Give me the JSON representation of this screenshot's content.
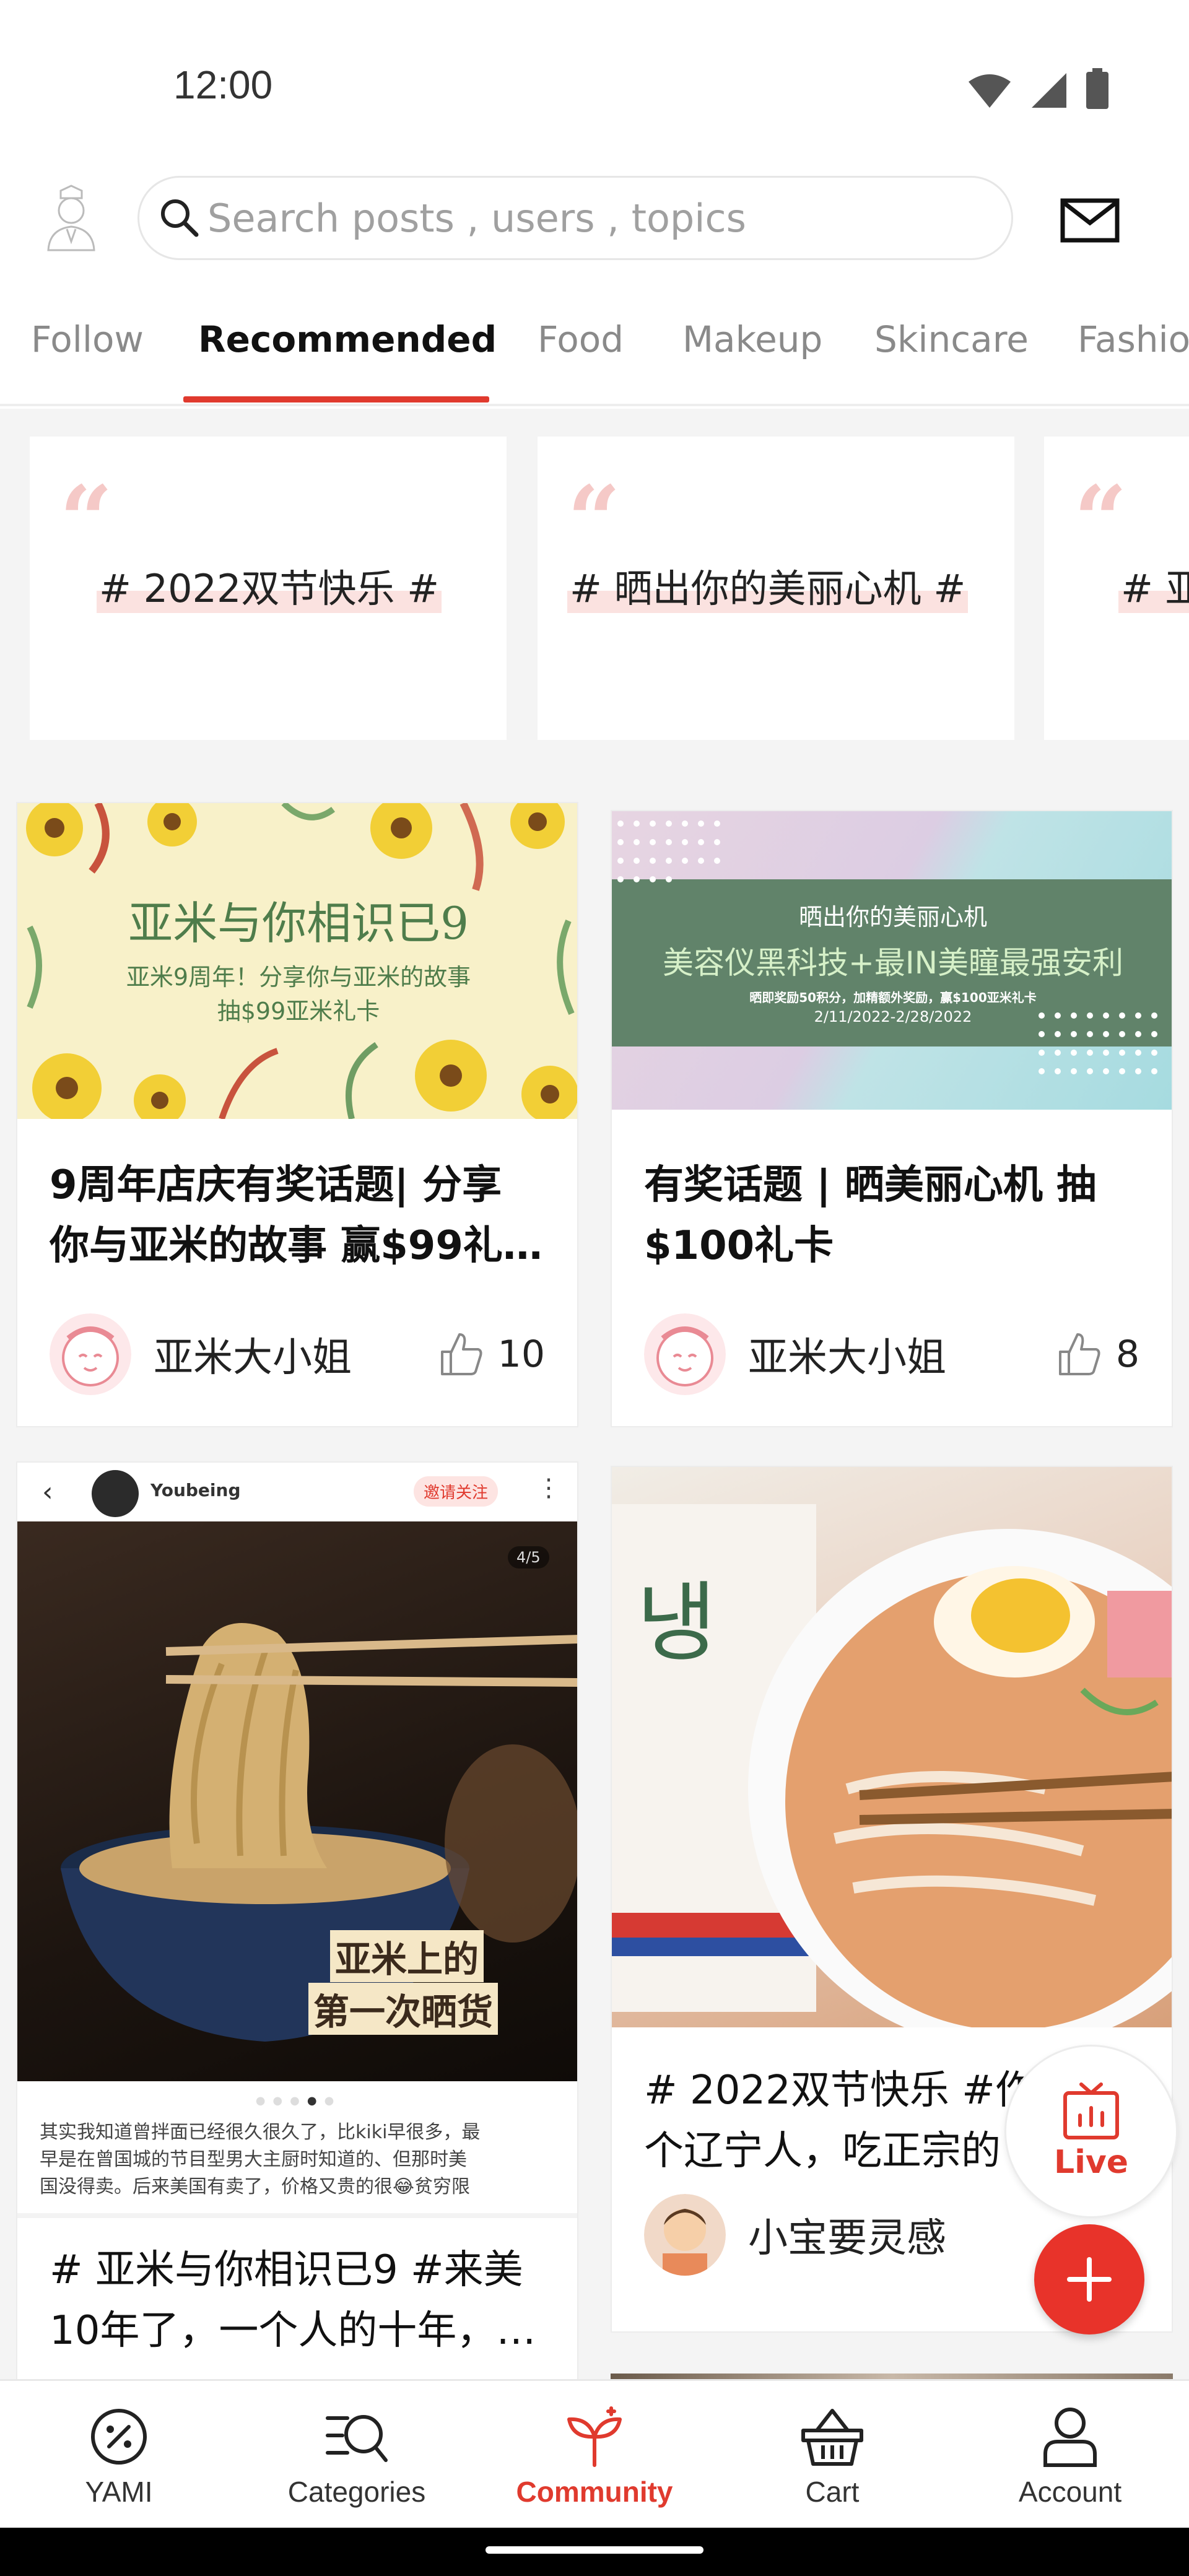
{
  "status_bar": {
    "time": "12:00"
  },
  "header": {
    "search_placeholder": "Search posts , users , topics",
    "icons": [
      "profile-avatar-icon",
      "search-icon",
      "mail-icon"
    ]
  },
  "tabs": [
    {
      "label": "Follow",
      "active": false
    },
    {
      "label": "Recommended",
      "active": true
    },
    {
      "label": "Food",
      "active": false
    },
    {
      "label": "Makeup",
      "active": false
    },
    {
      "label": "Skincare",
      "active": false
    },
    {
      "label": "Fashion",
      "active": false
    }
  ],
  "topics": [
    {
      "label": "# 2022双节快乐 #"
    },
    {
      "label": "# 晒出你的美丽心机 #"
    },
    {
      "label": "# 亚"
    }
  ],
  "posts": [
    {
      "banner_title": "亚米与你相识已9",
      "banner_line1": "亚米9周年！分享你与亚米的故事",
      "banner_line2": "抽$99亚米礼卡",
      "title_line1": "9周年店庆有奖话题| 分享",
      "title_line2": "你与亚米的故事 赢$99礼…",
      "author": "亚米大小姐",
      "likes": "10"
    },
    {
      "banner_top": "晒出你的美丽心机",
      "banner_main": "美容仪黑科技+最IN美瞳最强安利",
      "banner_small": "晒即奖励50积分，加精额外奖励，赢$100亚米礼卡",
      "banner_date": "2/11/2022-2/28/2022",
      "title_line1": "有奖话题 | 晒美丽心机 抽",
      "title_line2": "$100礼卡",
      "author": "亚米大小姐",
      "likes": "8"
    },
    {
      "embed_user": "Youbeing",
      "embed_follow": "邀请关注",
      "embed_counter": "4/5",
      "overlay_line1": "亚米上的",
      "overlay_line2": "第一次晒货",
      "caption_line1": "其实我知道曾拌面已经很久很久了，比kiki早很多，最",
      "caption_line2": "早是在曾国城的节目型男大主厨时知道的、但那时美",
      "caption_line3": "国没得卖。后来美国有卖了，价格又贵的很😂贫穷限",
      "title_line1": "# 亚米与你相识已9 #来美",
      "title_line2": "10年了，一个人的十年，…"
    },
    {
      "title_line1": "# 2022双节快乐 #作",
      "title_line2": "个辽宁人，吃正宗的",
      "author": "小宝要灵感"
    }
  ],
  "floating": {
    "live_label": "Live"
  },
  "bottom_nav": [
    {
      "label": "YAMI",
      "icon": "yami-discount-icon",
      "active": false
    },
    {
      "label": "Categories",
      "icon": "categories-search-icon",
      "active": false
    },
    {
      "label": "Community",
      "icon": "community-sprout-icon",
      "active": true
    },
    {
      "label": "Cart",
      "icon": "cart-basket-icon",
      "active": false
    },
    {
      "label": "Account",
      "icon": "account-person-icon",
      "active": false
    }
  ],
  "colors": {
    "accent": "#e03a2e",
    "add_button": "#e8332a",
    "tab_inactive": "#8a8a8a",
    "topic_highlight": "#fbe2e0"
  }
}
